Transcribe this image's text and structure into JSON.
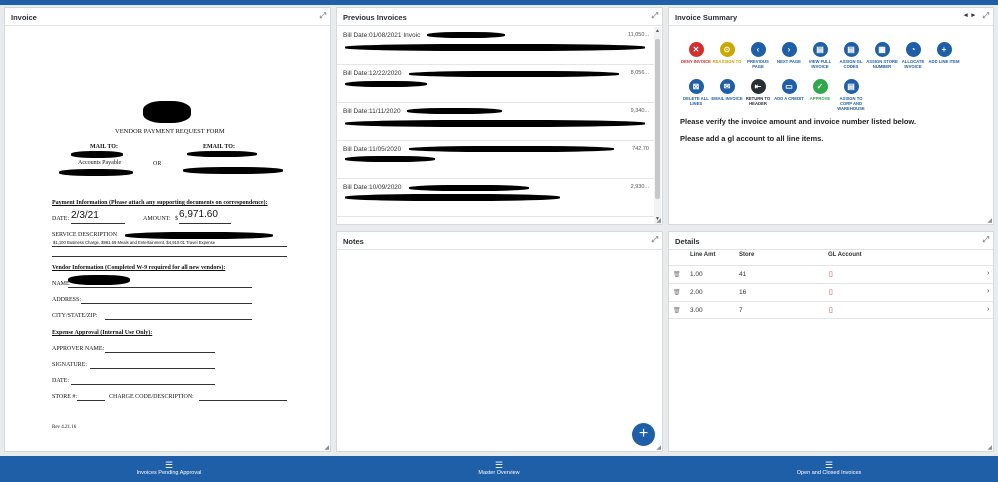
{
  "panels": {
    "invoice": "Invoice",
    "previous": "Previous Invoices",
    "summary": "Invoice Summary",
    "notes": "Notes",
    "details": "Details"
  },
  "document": {
    "title": "VENDOR PAYMENT REQUEST FORM",
    "mail_to": "MAIL TO:",
    "email_to": "EMAIL TO:",
    "accounts_payable": "Accounts Payable",
    "or": "OR",
    "payment_info": "Payment Information (Please attach any supporting documents on correspondence):",
    "date_label": "DATE:",
    "date_value": "2/3/21",
    "amount_label": "AMOUNT:",
    "amount_value": "6,971.60",
    "dollar": "$",
    "service_label": "SERVICE DESCRIPTION",
    "service_detail": "$1,100 Business Charge, $961.59 Meals and Entertainment, $4,910.01 Travel Expense",
    "vendor_info": "Vendor Information (Completed W-9 required for all new vendors):",
    "name": "NAME",
    "address": "ADDRESS:",
    "city": "CITY/STATE/ZIP:",
    "expense_approval": "Expense Approval (Internal Use Only):",
    "approver": "APPROVER NAME:",
    "signature": "SIGNATURE:",
    "date2": "DATE:",
    "store": "STORE #:",
    "charge": "CHARGE CODE/DESCRIPTION:",
    "rev": "Rev 4.21.16"
  },
  "previous_invoices": [
    {
      "label": "Bill Date:01/08/2021 Invoic",
      "amount": "11,050..."
    },
    {
      "label": "Bill Date:12/22/2020",
      "amount": "8,056..."
    },
    {
      "label": "Bill Date:11/11/2020",
      "amount": "9,340..."
    },
    {
      "label": "Bill Date:11/05/2020",
      "amount": "742.70"
    },
    {
      "label": "Bill Date:10/09/2020",
      "amount": "2,930..."
    }
  ],
  "actions": {
    "deny": "DENY INVOICE",
    "reassign": "REASSIGN TO",
    "prev_page": "PREVIOUS PAGE",
    "next_page": "NEXT PAGE",
    "view_full": "VIEW FULL INVOICE",
    "assign_gl": "ASSIGN GL CODES",
    "assign_store": "ASSIGN STORE NUMBER",
    "allocate": "ALLOCATE INVOICE",
    "add_line": "ADD LINE ITEM",
    "delete_all": "DELETE ALL LINES",
    "email": "EMAIL INVOICE",
    "return_header": "RETURN TO HEADER",
    "add_credit": "ADD A CREDIT",
    "approve": "APPROVE",
    "assign_corp": "ASSIGN TO CORP AND WAREHOUSE"
  },
  "messages": {
    "m1": "Please verify the invoice amount and invoice number listed below.",
    "m2": "Please add a gl account to all line items."
  },
  "details": {
    "headers": {
      "line_amt": "Line Amt",
      "store": "Store",
      "gl": "GL Account"
    },
    "rows": [
      {
        "amt": "1.00",
        "store": "41"
      },
      {
        "amt": "2.00",
        "store": "16"
      },
      {
        "amt": "3.00",
        "store": "7"
      }
    ]
  },
  "bottom_nav": {
    "pending": "Invoices Pending Approval",
    "master": "Master Overview",
    "closed": "Open and Closed Invoices"
  },
  "colors": {
    "primary": "#1f5fa8",
    "deny": "#d32f2f",
    "reassign": "#c9a800",
    "approve": "#2ea84a"
  }
}
